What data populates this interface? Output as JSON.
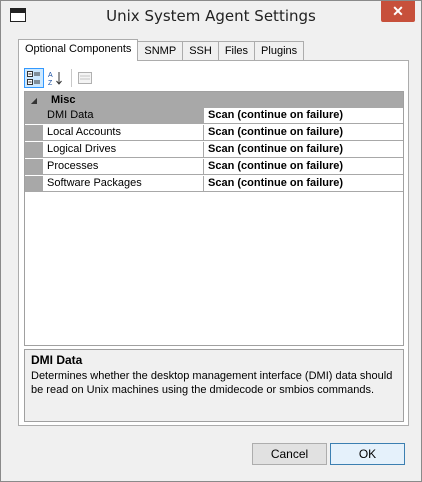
{
  "window": {
    "title": "Unix System Agent Settings",
    "close_glyph": "✕"
  },
  "tabs": [
    {
      "label": "Optional Components",
      "active": true
    },
    {
      "label": "SNMP",
      "active": false
    },
    {
      "label": "SSH",
      "active": false
    },
    {
      "label": "Files",
      "active": false
    },
    {
      "label": "Plugins",
      "active": false
    }
  ],
  "toolbar": {
    "categorized_icon": "categorized-icon",
    "alphabetical_icon": "alphabetical-sort-icon",
    "property_pages_icon": "property-pages-icon"
  },
  "grid": {
    "category": {
      "label": "Misc",
      "toggle_glyph": "◢"
    },
    "properties": [
      {
        "name": "DMI Data",
        "value": "Scan (continue on failure)",
        "selected": true
      },
      {
        "name": "Local Accounts",
        "value": "Scan (continue on failure)",
        "selected": false
      },
      {
        "name": "Logical Drives",
        "value": "Scan (continue on failure)",
        "selected": false
      },
      {
        "name": "Processes",
        "value": "Scan (continue on failure)",
        "selected": false
      },
      {
        "name": "Software Packages",
        "value": "Scan (continue on failure)",
        "selected": false
      }
    ]
  },
  "description": {
    "title": "DMI Data",
    "text": "Determines whether the desktop management interface (DMI) data should be read on Unix machines using the dmidecode or smbios commands."
  },
  "buttons": {
    "cancel": "Cancel",
    "ok": "OK"
  },
  "colors": {
    "close_button": "#c7503b",
    "grid_gutter": "#a8a8a8",
    "default_button_border": "#3c7fb1"
  }
}
